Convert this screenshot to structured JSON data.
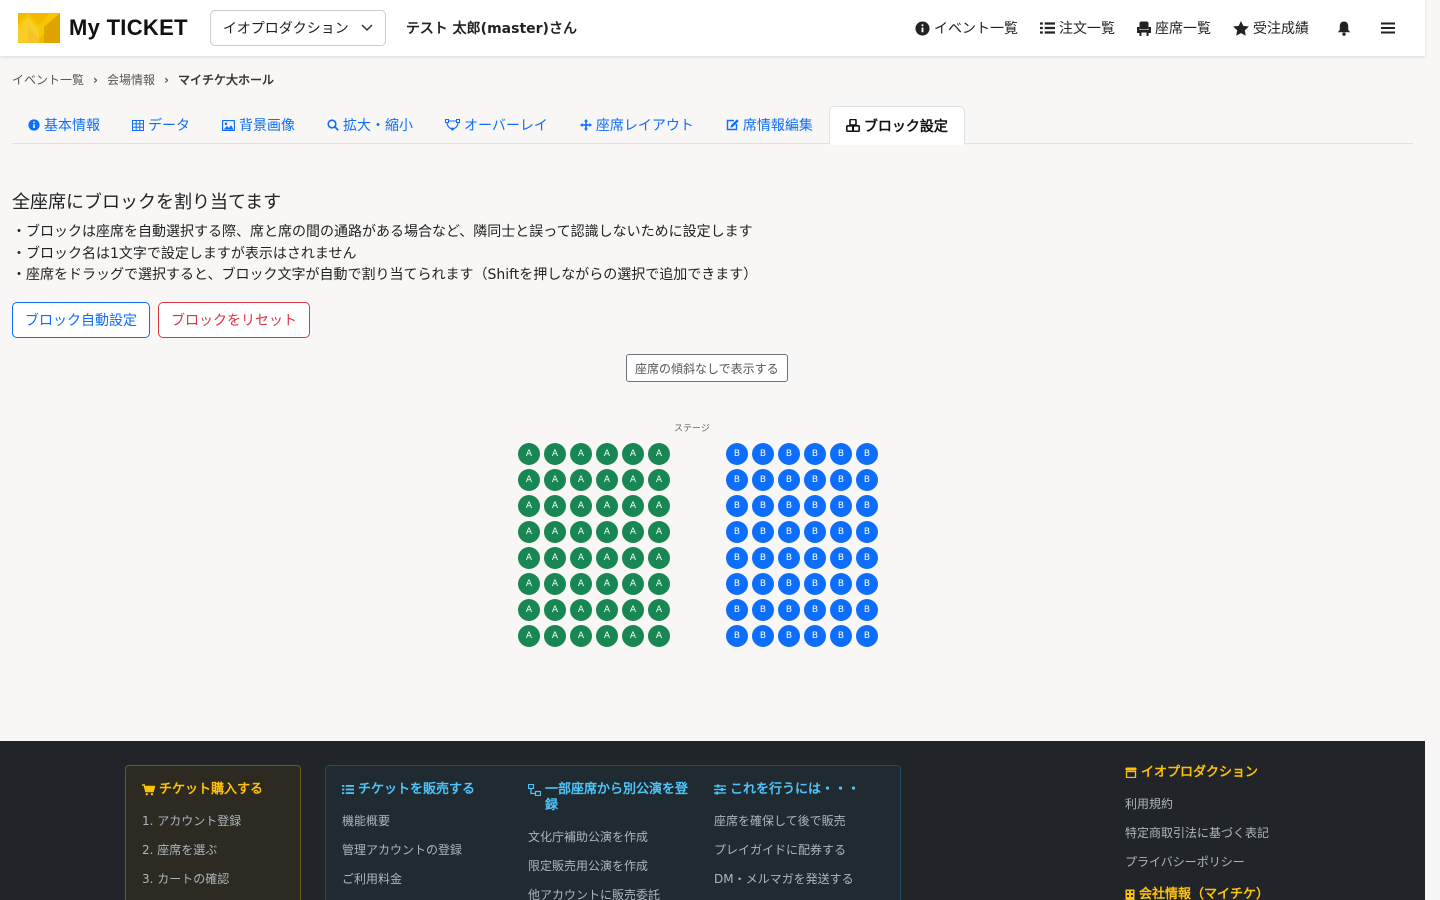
{
  "header": {
    "logo_text": "My TICKET",
    "org_select": "イオプロダクション",
    "user_name": "テスト 太郎(master)さん",
    "nav": [
      {
        "label": "イベント一覧",
        "icon": "info-circle-icon"
      },
      {
        "label": "注文一覧",
        "icon": "list-icon"
      },
      {
        "label": "座席一覧",
        "icon": "seat-icon"
      },
      {
        "label": "受注成績",
        "icon": "star-icon"
      }
    ],
    "bell_icon": "bell-icon",
    "menu_icon": "hamburger-icon"
  },
  "breadcrumb": [
    "イベント一覧",
    "会場情報",
    "マイチケ大ホール"
  ],
  "tabs": [
    {
      "label": "基本情報",
      "icon": "info-circle-icon",
      "active": false
    },
    {
      "label": "データ",
      "icon": "table-icon",
      "active": false
    },
    {
      "label": "背景画像",
      "icon": "image-icon",
      "active": false
    },
    {
      "label": "拡大・縮小",
      "icon": "search-icon",
      "active": false
    },
    {
      "label": "オーバーレイ",
      "icon": "bezier-icon",
      "active": false
    },
    {
      "label": "座席レイアウト",
      "icon": "move-icon",
      "active": false
    },
    {
      "label": "席情報編集",
      "icon": "edit-icon",
      "active": false
    },
    {
      "label": "ブロック設定",
      "icon": "cubes-icon",
      "active": true
    }
  ],
  "main": {
    "title": "全座席にブロックを割り当てます",
    "notes": [
      "・ブロックは座席を自動選択する際、席と席の間の通路がある場合など、隣同士と誤って認識しないために設定します",
      "・ブロック名は1文字で設定しますが表示はされません",
      "・座席をドラッグで選択すると、ブロック文字が自動で割り当てられます（Shiftを押しながらの選択で追加できます）"
    ],
    "auto_button": "ブロック自動設定",
    "reset_button": "ブロックをリセット",
    "tilt_button": "座席の傾斜なしで表示する",
    "stage_label": "ステージ"
  },
  "seat_map": {
    "blocks": [
      {
        "letter": "A",
        "rows": 8,
        "cols": 6,
        "color": "#198754"
      },
      {
        "letter": "B",
        "rows": 8,
        "cols": 6,
        "color": "#0d6efd"
      }
    ]
  },
  "footer": {
    "buy": {
      "title": "チケット購入する",
      "items": [
        "1. アカウント登録",
        "2. 座席を選ぶ",
        "3. カートの確認"
      ]
    },
    "sell": {
      "title": "チケットを販売する",
      "items": [
        "機能概要",
        "管理アカウントの登録",
        "ご利用料金"
      ]
    },
    "partial": {
      "title": "一部座席から別公演を登録",
      "items": [
        "文化庁補助公演を作成",
        "限定販売用公演を作成",
        "他アカウントに販売委託"
      ]
    },
    "howto": {
      "title": "これを行うには・・・",
      "items": [
        "座席を確保して後で販売",
        "プレイガイドに配券する",
        "DM・メルマガを発送する"
      ]
    },
    "company": {
      "title": "イオプロダクション",
      "items": [
        "利用規約",
        "特定商取引法に基づく表記",
        "プライバシーポリシー"
      ],
      "title2": "会社情報（マイチケ）"
    }
  }
}
